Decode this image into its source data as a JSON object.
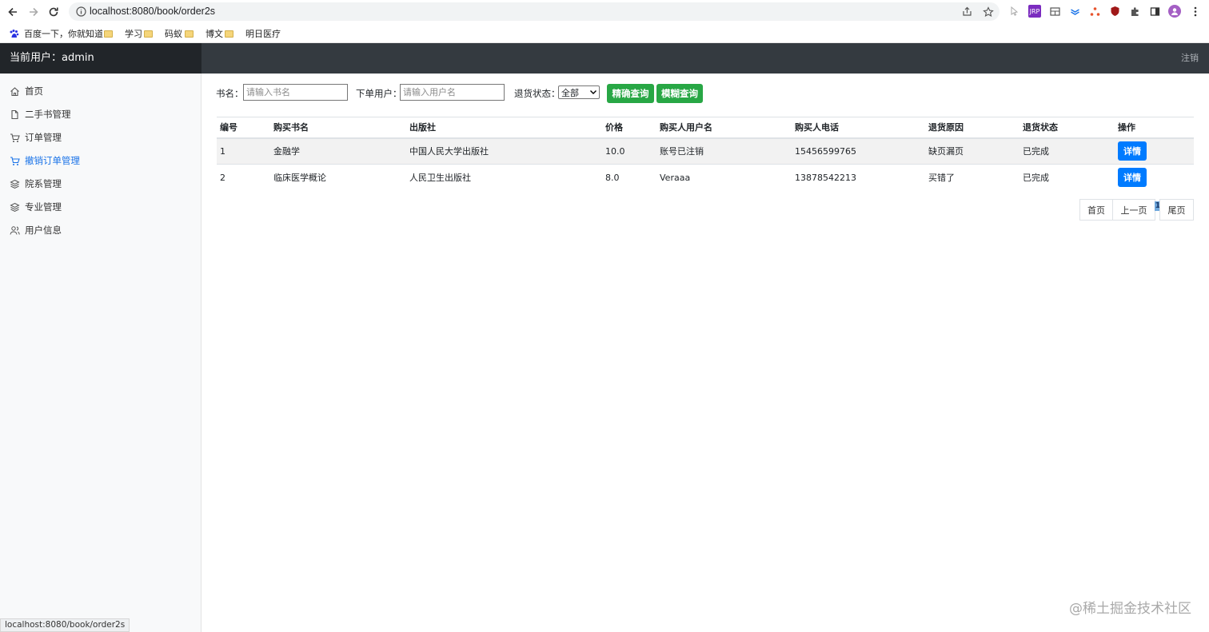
{
  "browser": {
    "url": "localhost:8080/book/order2s",
    "bookmarks": [
      "百度一下，你就知道",
      "学习",
      "码蚁",
      "博文",
      "明日医疗"
    ],
    "status_url": "localhost:8080/book/order2s"
  },
  "header": {
    "current_user": "当前用户：admin",
    "logout": "注销"
  },
  "sidebar": {
    "items": [
      {
        "label": "首页",
        "icon": "home-icon"
      },
      {
        "label": "二手书管理",
        "icon": "file-icon"
      },
      {
        "label": "订单管理",
        "icon": "cart-icon"
      },
      {
        "label": "撤销订单管理",
        "icon": "cart-icon",
        "active": true
      },
      {
        "label": "院系管理",
        "icon": "layers-icon"
      },
      {
        "label": "专业管理",
        "icon": "layers-icon"
      },
      {
        "label": "用户信息",
        "icon": "users-icon"
      }
    ],
    "active_color": "#1a73e8"
  },
  "filters": {
    "book_label": "书名：",
    "book_placeholder": "请输入书名",
    "user_label": "下单用户：",
    "user_placeholder": "请输入用户名",
    "status_label": "退货状态：",
    "status_value": "全部",
    "exact_search": "精确查询",
    "fuzzy_search": "模糊查询"
  },
  "table": {
    "headers": [
      "编号",
      "购买书名",
      "出版社",
      "价格",
      "购买人用户名",
      "购买人电话",
      "退货原因",
      "退货状态",
      "操作"
    ],
    "rows": [
      [
        "1",
        "金融学",
        "中国人民大学出版社",
        "10.0",
        "账号已注销",
        "15456599765",
        "缺页漏页",
        "已完成",
        "详情"
      ],
      [
        "2",
        "临床医学概论",
        "人民卫生出版社",
        "8.0",
        "Veraaa",
        "13878542213",
        "买错了",
        "已完成",
        "详情"
      ]
    ]
  },
  "pagination": {
    "first": "首页",
    "prev": "上一页",
    "current": "1",
    "last": "尾页"
  },
  "watermark": "@稀土掘金技术社区",
  "colors": {
    "header_bg": "#343a40",
    "brand_bg": "#212529",
    "green": "#28a745",
    "blue": "#007bff"
  }
}
